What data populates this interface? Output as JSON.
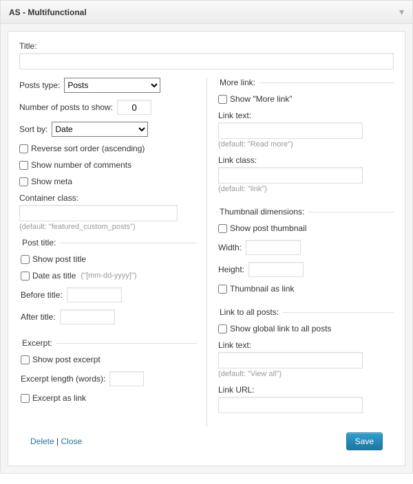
{
  "header": {
    "title": "AS - Multifunctional"
  },
  "title_section": {
    "label": "Title:",
    "value": ""
  },
  "left": {
    "posts_type": {
      "label": "Posts type:",
      "value": "Posts"
    },
    "num_posts": {
      "label": "Number of posts to show:",
      "value": "0"
    },
    "sort_by": {
      "label": "Sort by:",
      "value": "Date"
    },
    "reverse": {
      "label": "Reverse sort order (ascending)"
    },
    "show_comments": {
      "label": "Show number of comments"
    },
    "show_meta": {
      "label": "Show meta"
    },
    "container_class": {
      "label": "Container class:",
      "value": "",
      "hint": "(default: \"featured_custom_posts\")"
    },
    "post_title_fs": {
      "legend": "Post title:",
      "show": {
        "label": "Show post title"
      },
      "date_as_title": {
        "label": "Date as title",
        "hint": "(\"[mm-dd-yyyy]\")"
      },
      "before": {
        "label": "Before title:",
        "value": ""
      },
      "after": {
        "label": "After title:",
        "value": ""
      }
    },
    "excerpt_fs": {
      "legend": "Excerpt:",
      "show": {
        "label": "Show post excerpt"
      },
      "length": {
        "label": "Excerpt length (words):",
        "value": ""
      },
      "as_link": {
        "label": "Excerpt as link"
      }
    }
  },
  "right": {
    "more_fs": {
      "legend": "More link:",
      "show": {
        "label": "Show \"More link\""
      },
      "link_text": {
        "label": "Link text:",
        "value": "",
        "hint": "(default: \"Read more\")"
      },
      "link_class": {
        "label": "Link class:",
        "value": "",
        "hint": "(default: \"link\")"
      }
    },
    "thumb_fs": {
      "legend": "Thumbnail dimensions:",
      "show": {
        "label": "Show post thumbnail"
      },
      "width": {
        "label": "Width:",
        "value": ""
      },
      "height": {
        "label": "Height:",
        "value": ""
      },
      "as_link": {
        "label": "Thumbnail as link"
      }
    },
    "all_fs": {
      "legend": "Link to all posts:",
      "show": {
        "label": "Show global link to all posts"
      },
      "link_text": {
        "label": "Link text:",
        "value": "",
        "hint": "(default: \"View all\")"
      },
      "link_url": {
        "label": "Link URL:",
        "value": ""
      }
    }
  },
  "footer": {
    "delete": "Delete",
    "close": "Close",
    "save": "Save"
  }
}
